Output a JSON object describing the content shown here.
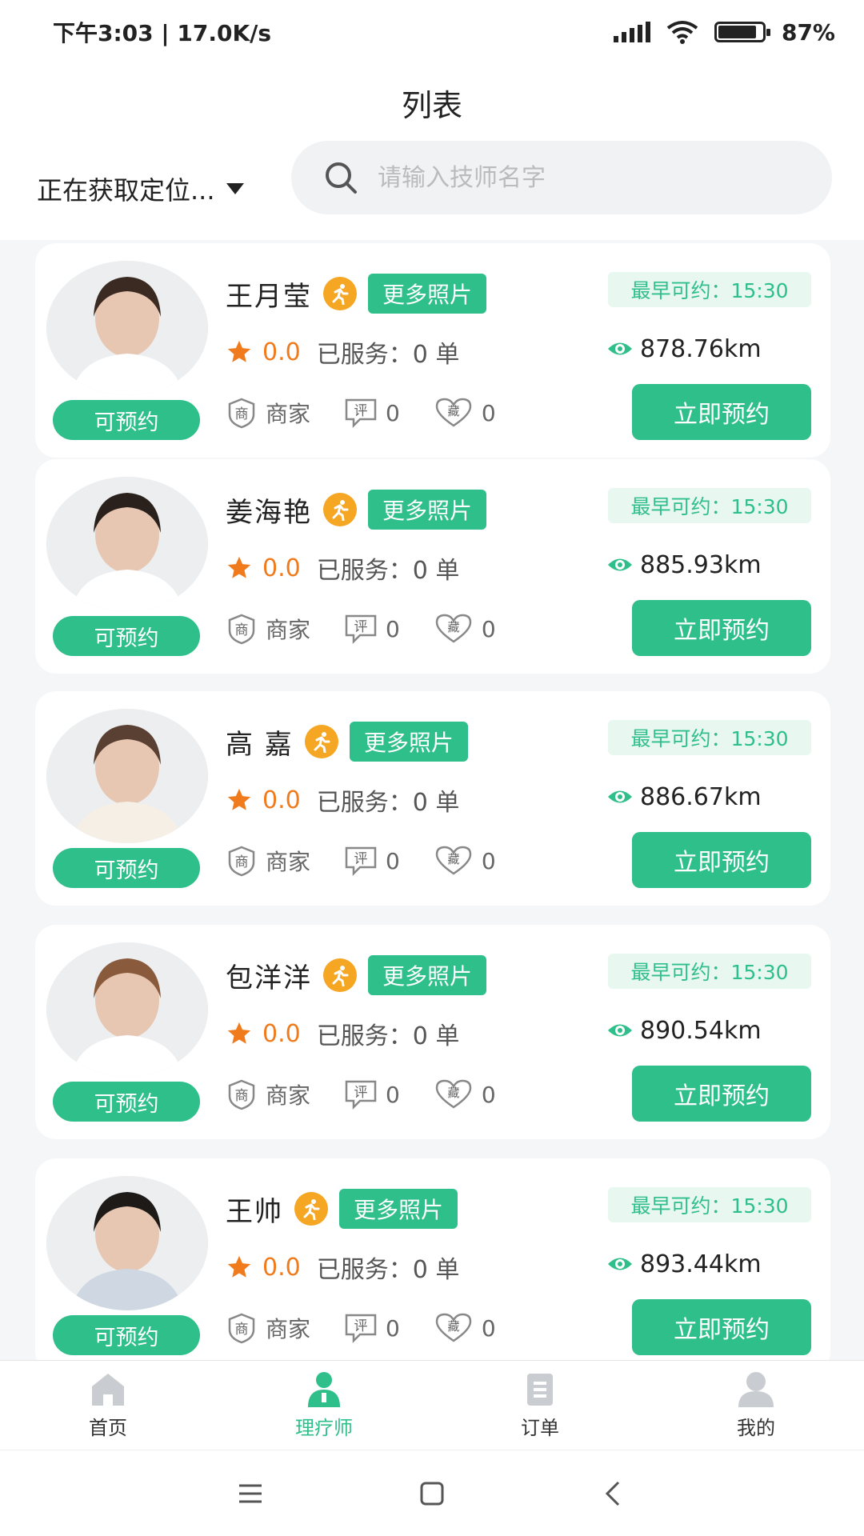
{
  "status_bar": {
    "time_speed": "下午3:03 | 17.0K/s",
    "battery": "87%",
    "battery_level": 0.87
  },
  "header": {
    "title": "列表"
  },
  "location": {
    "label": "正在获取定位..."
  },
  "search": {
    "placeholder": "请输入技师名字",
    "value": ""
  },
  "accent_color": "#2ebf8b",
  "technicians": [
    {
      "name": "王月莹",
      "photos_label": "更多照片",
      "earliest": "最早可约：15:30",
      "rating": "0.0",
      "served": "已服务：0 单",
      "distance": "878.76km",
      "status": "可预约",
      "merchant_badge": "商",
      "merchant": "商家",
      "review_badge": "评",
      "reviews": "0",
      "fav_badge": "藏",
      "favorites": "0",
      "book_label": "立即预约"
    },
    {
      "name": "姜海艳",
      "photos_label": "更多照片",
      "earliest": "最早可约：15:30",
      "rating": "0.0",
      "served": "已服务：0 单",
      "distance": "885.93km",
      "status": "可预约",
      "merchant_badge": "商",
      "merchant": "商家",
      "review_badge": "评",
      "reviews": "0",
      "fav_badge": "藏",
      "favorites": "0",
      "book_label": "立即预约"
    },
    {
      "name": "高 嘉",
      "photos_label": "更多照片",
      "earliest": "最早可约：15:30",
      "rating": "0.0",
      "served": "已服务：0 单",
      "distance": "886.67km",
      "status": "可预约",
      "merchant_badge": "商",
      "merchant": "商家",
      "review_badge": "评",
      "reviews": "0",
      "fav_badge": "藏",
      "favorites": "0",
      "book_label": "立即预约"
    },
    {
      "name": "包洋洋",
      "photos_label": "更多照片",
      "earliest": "最早可约：15:30",
      "rating": "0.0",
      "served": "已服务：0 单",
      "distance": "890.54km",
      "status": "可预约",
      "merchant_badge": "商",
      "merchant": "商家",
      "review_badge": "评",
      "reviews": "0",
      "fav_badge": "藏",
      "favorites": "0",
      "book_label": "立即预约"
    },
    {
      "name": "王帅",
      "photos_label": "更多照片",
      "earliest": "最早可约：15:30",
      "rating": "0.0",
      "served": "已服务：0 单",
      "distance": "893.44km",
      "status": "可预约",
      "merchant_badge": "商",
      "merchant": "商家",
      "review_badge": "评",
      "reviews": "0",
      "fav_badge": "藏",
      "favorites": "0",
      "book_label": "立即预约"
    }
  ],
  "tabs": [
    {
      "label": "首页",
      "icon": "home-icon"
    },
    {
      "label": "理疗师",
      "icon": "therapist-icon",
      "active": true
    },
    {
      "label": "订单",
      "icon": "order-icon"
    },
    {
      "label": "我的",
      "icon": "profile-icon"
    }
  ]
}
